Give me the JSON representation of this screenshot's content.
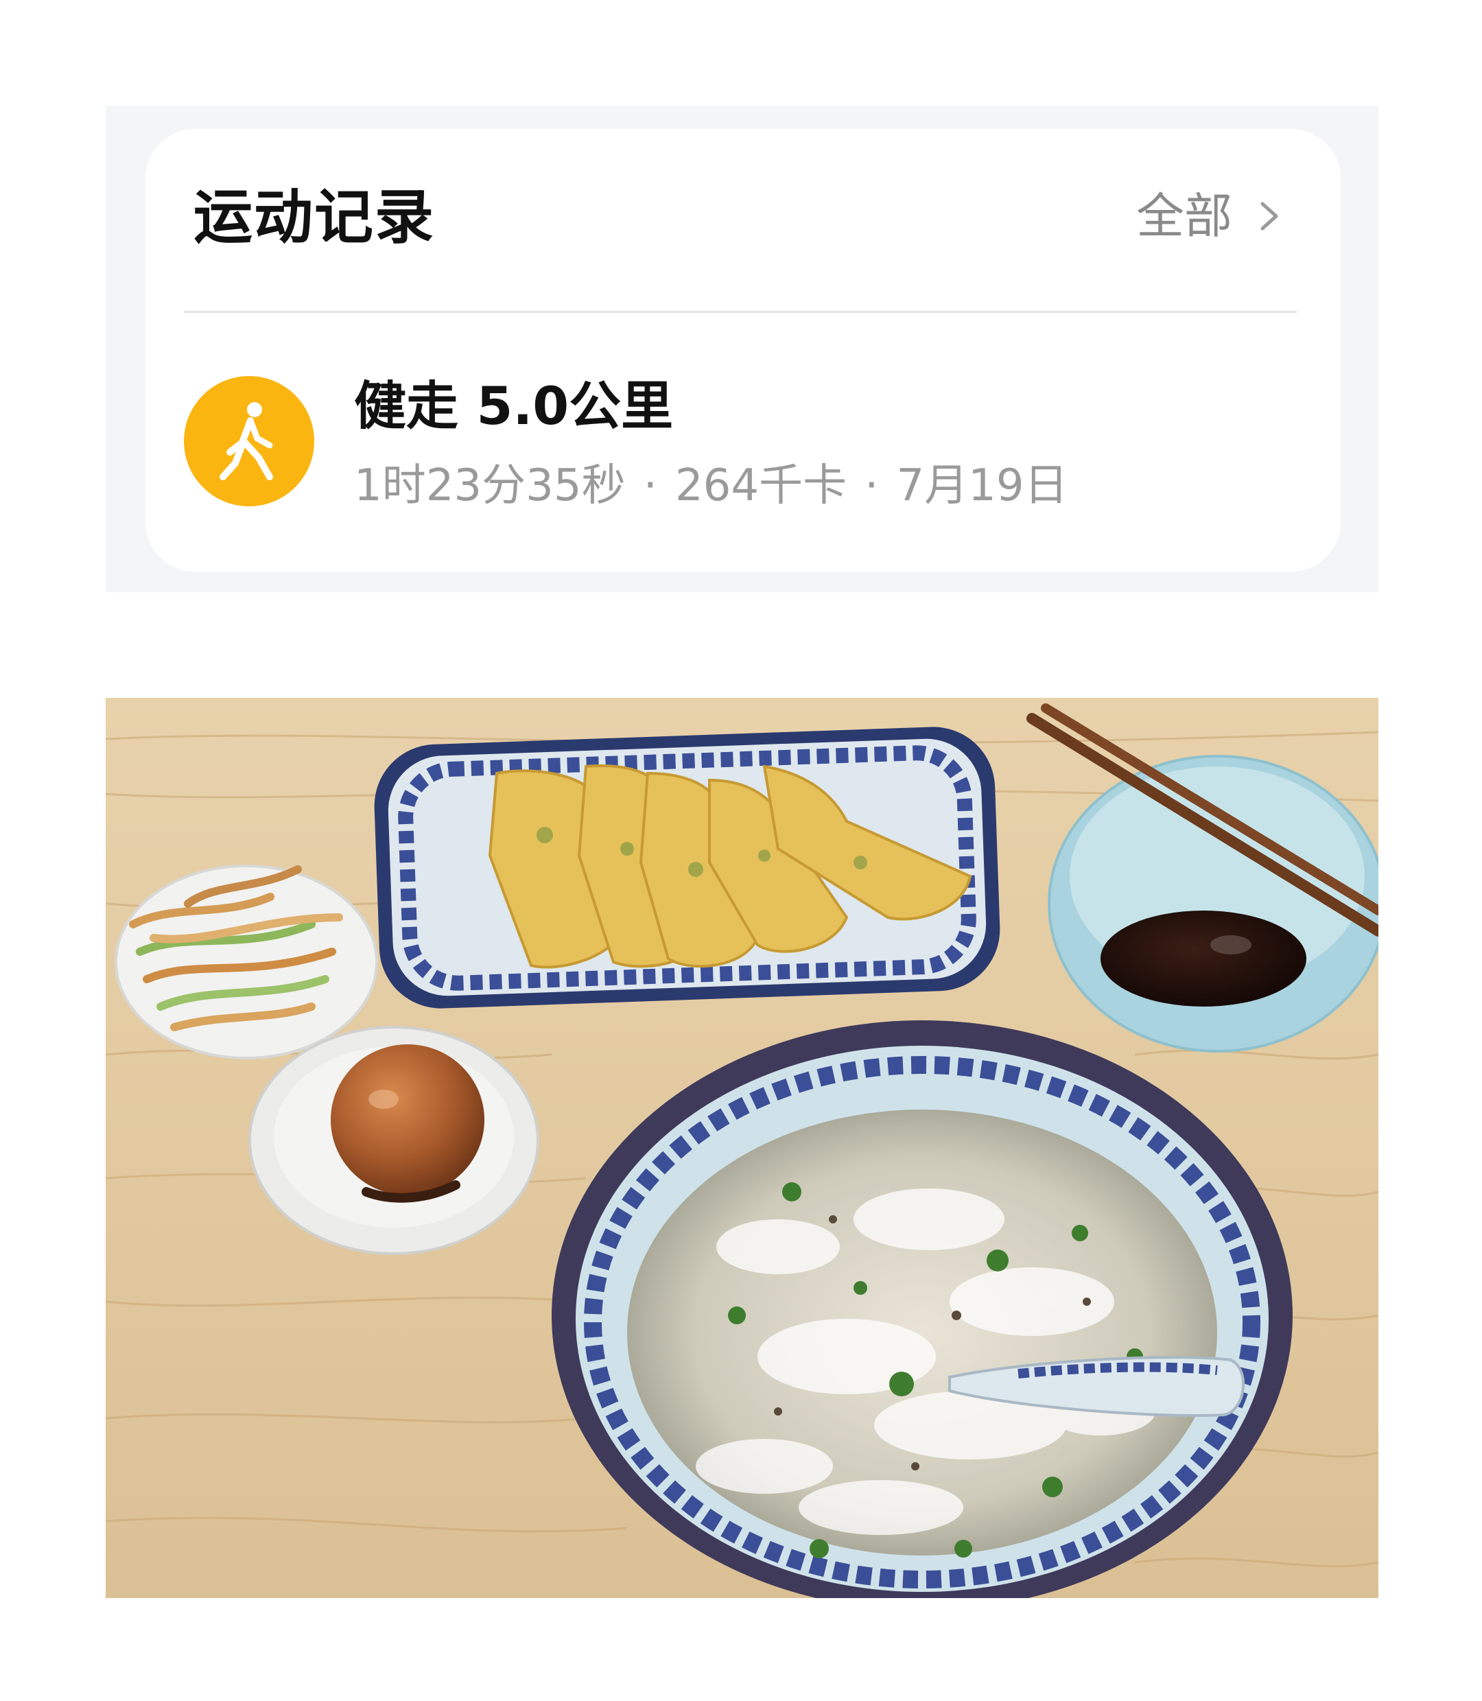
{
  "records_card": {
    "title": "运动记录",
    "all_label": "全部",
    "chevron_icon": "chevron-right-icon",
    "item": {
      "icon": "walking-person-icon",
      "icon_color": "#fbb510",
      "title": "健走 5.0公里",
      "duration": "1时23分35秒",
      "calories": "264千卡",
      "date": "7月19日",
      "separator": "·"
    }
  },
  "photo": {
    "subject": "dumplings, soup, tea egg, pickled vegetables, dipping sauce on wooden table"
  }
}
